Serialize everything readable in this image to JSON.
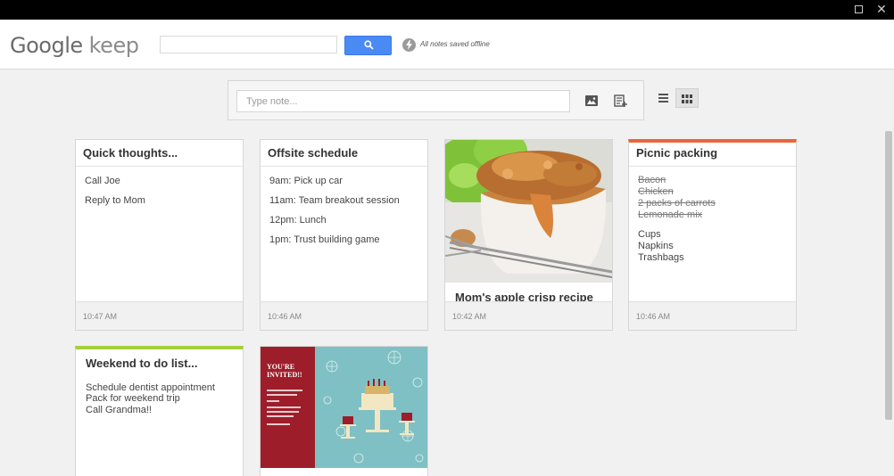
{
  "window": {
    "maximize_label": "",
    "close_label": "✕"
  },
  "header": {
    "logo_google": "Google",
    "logo_keep": "keep",
    "search": {
      "value": "",
      "placeholder": ""
    },
    "offline_status": "All notes saved offline"
  },
  "composer": {
    "placeholder": "Type note..."
  },
  "notes": [
    {
      "title": "Quick thoughts...",
      "lines": [
        "Call Joe",
        "Reply to Mom"
      ],
      "time": "10:47 AM"
    },
    {
      "title": "Offsite schedule",
      "lines": [
        "9am: Pick up car",
        "11am: Team breakout session",
        "12pm: Lunch",
        "1pm: Trust building game"
      ],
      "time": "10:46 AM"
    },
    {
      "title": "Mom's apple crisp recipe",
      "time": "10:42 AM"
    },
    {
      "title": "Picnic packing",
      "checked": [
        "Bacon",
        "Chicken",
        "2 packs of carrots",
        "Lemonade mix"
      ],
      "unchecked": [
        "Cups",
        "Napkins",
        "Trashbags"
      ],
      "time": "10:46 AM",
      "accent": "#e8663d"
    },
    {
      "title": "Weekend to do list...",
      "lines": [
        "Schedule dentist appointment",
        "Pack for weekend trip",
        "Call Grandma!!"
      ],
      "accent": "#a5cf3c"
    },
    {
      "invite_heading": [
        "YOU'RE",
        "INVITED!!"
      ]
    }
  ],
  "colors": {
    "search_button": "#4a8af4",
    "invite_red": "#9d1e2a",
    "invite_teal": "#7fc0c4"
  },
  "icons": [
    "search-icon",
    "offline-bolt-icon",
    "image-icon",
    "new-list-icon",
    "list-view-icon",
    "grid-view-icon",
    "maximize-icon",
    "close-icon"
  ]
}
